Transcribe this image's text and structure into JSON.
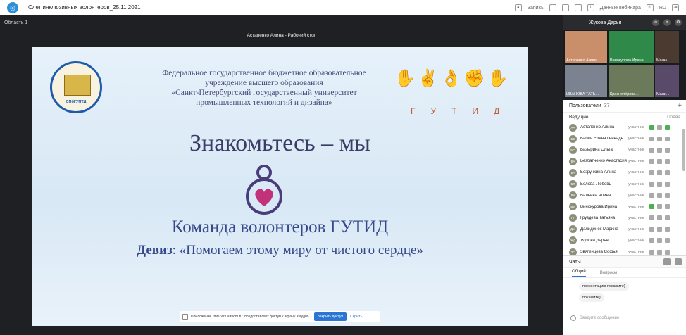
{
  "header": {
    "title": "Слет инклюзивных волонтеров_25.11.2021",
    "record": "Запись",
    "webinar_data": "Данные вебинара",
    "lang": "RU"
  },
  "stage": {
    "area_label": "Область 1",
    "share_title": "Астапенко Алина - Рабочий стол"
  },
  "slide": {
    "emblem_text": "СПбГУПТД",
    "org_lines": [
      "Федеральное государственное бюджетное образовательное",
      "учреждение высшего образования",
      "«Санкт-Петербургский государственный университет",
      "промышленных технологий и дизайна»"
    ],
    "gutid_letters": "ГУТИД",
    "heading": "Знакомьтесь – мы",
    "team": "Команда волонтеров ГУТИД",
    "motto_label": "Девиз",
    "motto_text": ": «Помогаем этому миру от чистого сердце»"
  },
  "notice": {
    "text": "Приложение \"mr1.virtualroom.ru\" предоставляет доступ к экрану и аудио.",
    "stop": "Закрыть доступ",
    "hide": "Скрыть"
  },
  "panel": {
    "presenter": "Жукова Дарья",
    "video_names": [
      "Астапенко Алина",
      "Винокурова Ирина",
      "Малы...",
      "ИВАНОВА ТАТЬ...",
      "Краснопёрова...",
      "Мали..."
    ],
    "participants_label": "Пользователи",
    "participants_count": "37",
    "leads_label": "Ведущие",
    "rights_label": "Права",
    "participants": [
      {
        "initials": "АА",
        "name": "Астапенко Алина",
        "role": "участник"
      },
      {
        "initials": "БЕ",
        "name": "Бабич Елена Геннадь...",
        "role": "участник"
      },
      {
        "initials": "БО",
        "name": "Базырина Ольга",
        "role": "участник"
      },
      {
        "initials": "БА",
        "name": "Безбатченко Анастасия",
        "role": "участник"
      },
      {
        "initials": "БА",
        "name": "Безручкина Алина",
        "role": "участник"
      },
      {
        "initials": "БЛ",
        "name": "Белова Любовь",
        "role": "участник"
      },
      {
        "initials": "ВА",
        "name": "Валеева Алина",
        "role": "участник"
      },
      {
        "initials": "ВИ",
        "name": "Винокурова Ирина",
        "role": "участник"
      },
      {
        "initials": "ГТ",
        "name": "Груздева Татьяна",
        "role": "участник"
      },
      {
        "initials": "ДМ",
        "name": "Далидёнок Марина",
        "role": "участник"
      },
      {
        "initials": "ЖД",
        "name": "Жукова Дарья",
        "role": "участник"
      },
      {
        "initials": "ЗС",
        "name": "Звягинцева Софья",
        "role": "участник"
      }
    ],
    "chat_label": "Чаты",
    "chat_tabs": [
      "Общий",
      "Вопросы"
    ],
    "messages": [
      "презентацию покажите)",
      "покажите)"
    ],
    "input_placeholder": "Введите сообщение"
  },
  "colors": {
    "accent": "#2b76d3",
    "dark_bg": "#1f2023",
    "mic_on": "#4caf50"
  }
}
